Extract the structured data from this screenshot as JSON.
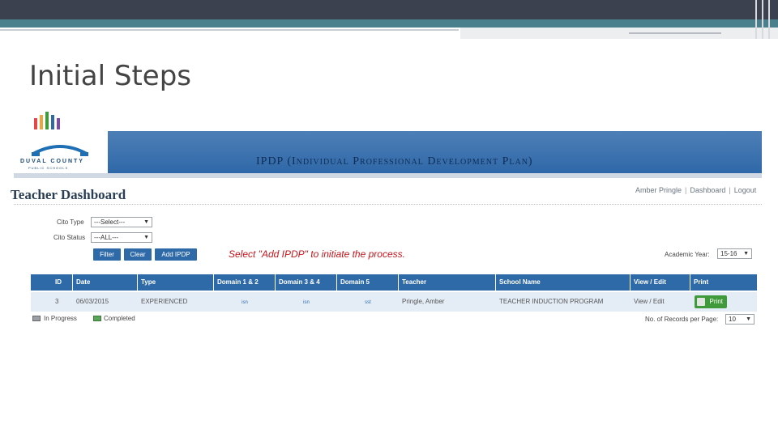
{
  "slide": {
    "title": "Initial Steps"
  },
  "banner": {
    "logo_line1": "DUVAL COUNTY",
    "logo_line2": "PUBLIC SCHOOLS",
    "title": "IPDP (Individual Professional Development Plan)"
  },
  "dashboard": {
    "title": "Teacher Dashboard",
    "user_name": "Amber Pringle",
    "dashboard_link": "Dashboard",
    "logout_link": "Logout",
    "separator": "|"
  },
  "filters": {
    "type_label": "Cito Type",
    "type_value": "---Select---",
    "status_label": "Cito Status",
    "status_value": "---ALL---",
    "filter_button": "Filter",
    "clear_button": "Clear",
    "add_button": "Add IPDP",
    "academic_year_label": "Academic Year:",
    "academic_year_value": "15-16"
  },
  "annotation": "Select \"Add IPDP\" to initiate the process.",
  "table": {
    "columns": [
      "ID",
      "Date",
      "Type",
      "Domain 1 & 2",
      "Domain 3 & 4",
      "Domain 5",
      "Teacher",
      "School Name",
      "View / Edit",
      "Print"
    ],
    "rows": [
      {
        "id": "3",
        "date": "06/03/2015",
        "type": "EXPERIENCED",
        "domain12": "isn",
        "domain34": "isn",
        "domain5": "sst",
        "teacher": "Pringle, Amber",
        "school": "TEACHER INDUCTION PROGRAM",
        "view_edit": "View / Edit",
        "print": "Print"
      }
    ]
  },
  "legend": {
    "in_progress": "In Progress",
    "completed": "Completed"
  },
  "pagination": {
    "records_label": "No. of Records per Page:",
    "records_value": "10"
  },
  "colors": {
    "accent_blue": "#2f6aa8",
    "annotation_red": "#c4161c",
    "print_green": "#3e9a3a"
  }
}
